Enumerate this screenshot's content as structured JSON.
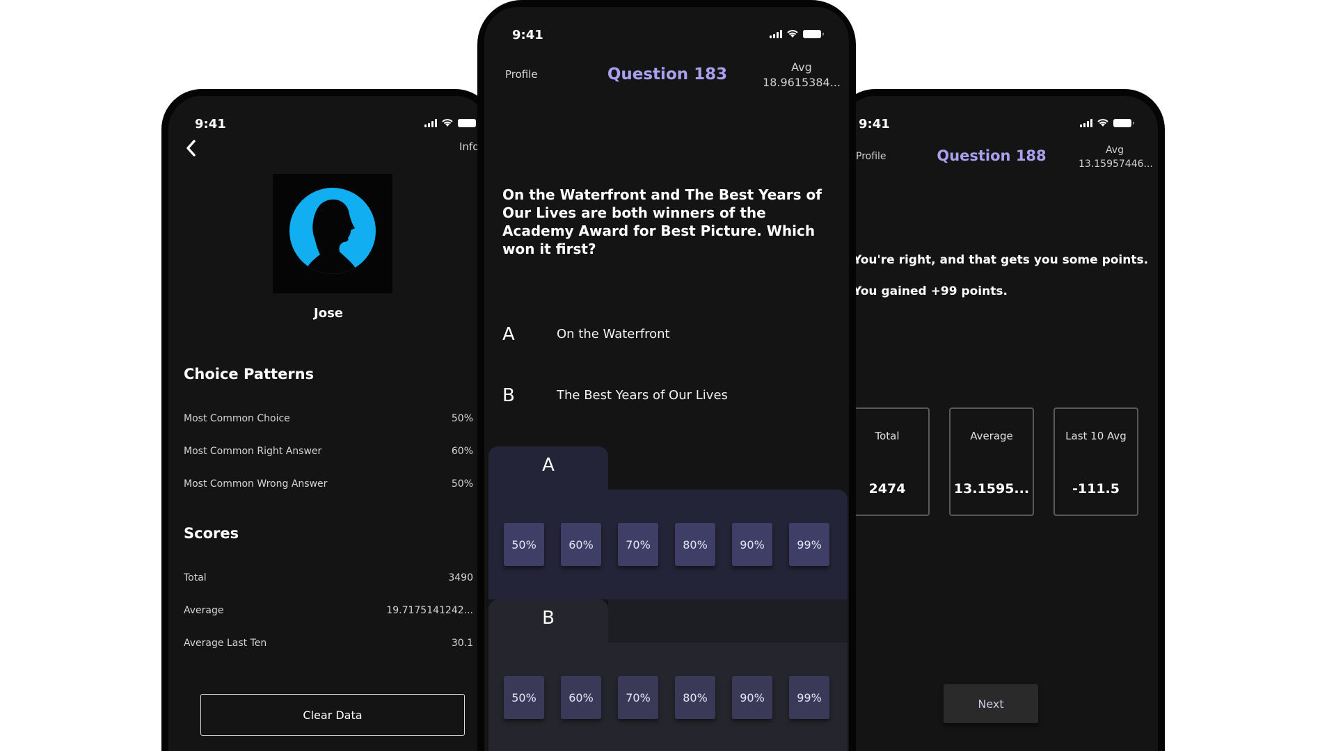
{
  "left": {
    "time": "9:41",
    "info_label": "Info",
    "name": "Jose",
    "choice_patterns_title": "Choice Patterns",
    "choice_patterns": [
      {
        "label": "Most Common Choice",
        "value": "50%"
      },
      {
        "label": "Most Common Right Answer",
        "value": "60%"
      },
      {
        "label": "Most Common Wrong Answer",
        "value": "50%"
      }
    ],
    "scores_title": "Scores",
    "scores": [
      {
        "label": "Total",
        "value": "3490"
      },
      {
        "label": "Average",
        "value": "19.7175141242..."
      },
      {
        "label": "Average Last Ten",
        "value": "30.1"
      }
    ],
    "clear_label": "Clear Data"
  },
  "center": {
    "time": "9:41",
    "profile_label": "Profile",
    "title": "Question 183",
    "avg_label": "Avg",
    "avg_value": "18.9615384...",
    "question": "On the Waterfront and The Best Years of Our Lives are both winners of the Academy Award for Best Picture.  Which won it first?",
    "choices": [
      {
        "letter": "A",
        "text": "On the Waterfront"
      },
      {
        "letter": "B",
        "text": "The Best Years of Our Lives"
      }
    ],
    "panel_a_label": "A",
    "panel_b_label": "B",
    "confidence": [
      "50%",
      "60%",
      "70%",
      "80%",
      "90%",
      "99%"
    ]
  },
  "right": {
    "time": "9:41",
    "profile_label": "Profile",
    "title": "Question 188",
    "avg_label": "Avg",
    "avg_value": "13.15957446...",
    "message1": "You're right, and that gets you some points.",
    "message2": "You gained +99 points.",
    "stats": [
      {
        "label": "Total",
        "value": "2474"
      },
      {
        "label": "Average",
        "value": "13.1595..."
      },
      {
        "label": "Last 10 Avg",
        "value": "-111.5"
      }
    ],
    "next_label": "Next"
  },
  "colors": {
    "accent": "#a9a0f0",
    "avatar_bg": "#12aef2",
    "panel": "#242438",
    "chip": "#3e3e66"
  }
}
